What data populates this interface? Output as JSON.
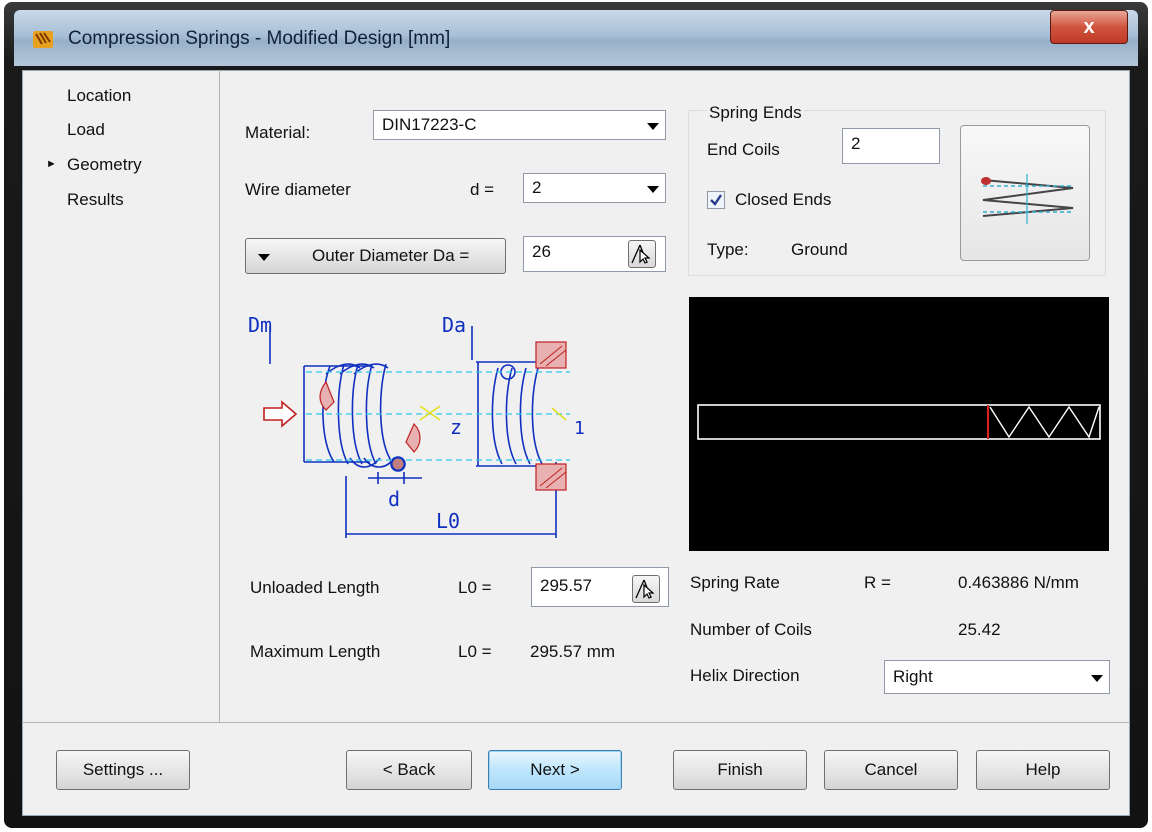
{
  "window": {
    "title": "Compression Springs - Modified Design [mm]",
    "close_glyph": "x"
  },
  "nav": {
    "items": [
      {
        "label": "Location"
      },
      {
        "label": "Load"
      },
      {
        "label": "Geometry",
        "active": true
      },
      {
        "label": "Results"
      }
    ]
  },
  "material": {
    "label": "Material:",
    "value": "DIN17223-C"
  },
  "wire": {
    "label": "Wire diameter",
    "symbol": "d =",
    "value": "2"
  },
  "diameter": {
    "mode_label": "Outer Diameter Da =",
    "value": "26"
  },
  "spring_ends": {
    "group_label": "Spring Ends",
    "end_coils_label": "End Coils",
    "end_coils_value": "2",
    "closed_ends_label": "Closed Ends",
    "closed_ends_checked": true,
    "type_label": "Type:",
    "type_value": "Ground"
  },
  "diagram": {
    "dm": "Dm",
    "da": "Da",
    "d": "d",
    "z": "z",
    "l0": "L0",
    "one": "1"
  },
  "unloaded": {
    "label": "Unloaded Length",
    "symbol": "L0 =",
    "value": "295.57"
  },
  "maximum": {
    "label": "Maximum Length",
    "symbol": "L0 =",
    "value": "295.57 mm"
  },
  "results": {
    "spring_rate_label": "Spring Rate",
    "spring_rate_symbol": "R =",
    "spring_rate_value": "0.463886 N/mm",
    "coils_label": "Number of Coils",
    "coils_value": "25.42",
    "helix_label": "Helix Direction",
    "helix_value": "Right"
  },
  "buttons": {
    "settings": "Settings ...",
    "back": "< Back",
    "next": "Next >",
    "finish": "Finish",
    "cancel": "Cancel",
    "help": "Help"
  },
  "colors": {
    "accent": "#3c7fb1",
    "preview_bg": "#000000",
    "diagram_blue": "#1030c0",
    "diagram_red": "#c02020"
  }
}
